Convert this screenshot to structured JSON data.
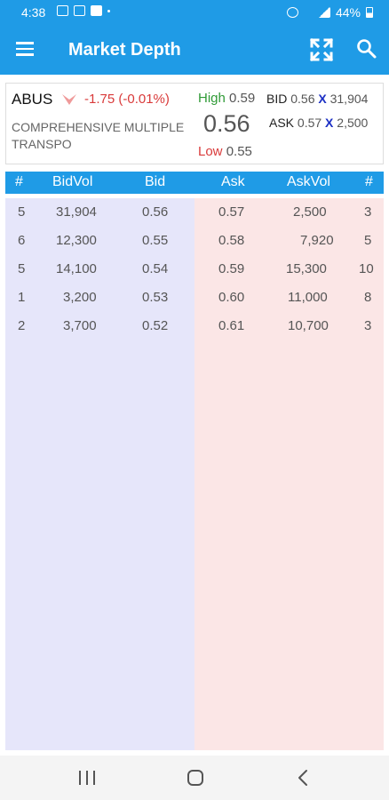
{
  "status_bar": {
    "time": "4:38",
    "battery": "44%"
  },
  "app_bar": {
    "title": "Market Depth"
  },
  "quote": {
    "symbol": "ABUS",
    "change": "-1.75 (-0.01%)",
    "company_name": "COMPREHENSIVE MULTIPLE TRANSPO",
    "high_label": "High",
    "high_value": "0.59",
    "last": "0.56",
    "low_label": "Low",
    "low_value": "0.55",
    "bid_label": "BID",
    "bid_price": "0.56",
    "bid_x": "X",
    "bid_volume": "31,904",
    "ask_label": "ASK",
    "ask_price": "0.57",
    "ask_x": "X",
    "ask_volume": "2,500"
  },
  "table": {
    "headers": {
      "bid_count": "#",
      "bid_vol": "BidVol",
      "bid": "Bid",
      "ask": "Ask",
      "ask_vol": "AskVol",
      "ask_count": "#"
    },
    "rows": [
      {
        "bid_count": "5",
        "bid_vol": "31,904",
        "bid": "0.56",
        "ask": "0.57",
        "ask_vol": "2,500",
        "ask_count": "3"
      },
      {
        "bid_count": "6",
        "bid_vol": "12,300",
        "bid": "0.55",
        "ask": "0.58",
        "ask_vol": "7,920",
        "ask_count": "5"
      },
      {
        "bid_count": "5",
        "bid_vol": "14,100",
        "bid": "0.54",
        "ask": "0.59",
        "ask_vol": "15,300",
        "ask_count": "10"
      },
      {
        "bid_count": "1",
        "bid_vol": "3,200",
        "bid": "0.53",
        "ask": "0.60",
        "ask_vol": "11,000",
        "ask_count": "8"
      },
      {
        "bid_count": "2",
        "bid_vol": "3,700",
        "bid": "0.52",
        "ask": "0.61",
        "ask_vol": "10,700",
        "ask_count": "3"
      }
    ]
  },
  "colors": {
    "primary": "#1f9be6",
    "bid_bg": "#e6e6fa",
    "ask_bg": "#fbe6e6",
    "up": "#2f9a36",
    "down": "#d93a3a",
    "x_mark": "#1b2fc4"
  },
  "icons": [
    "menu-icon",
    "expand-icon",
    "search-icon",
    "down-arrow-icon",
    "recents-icon",
    "home-icon",
    "back-icon"
  ]
}
